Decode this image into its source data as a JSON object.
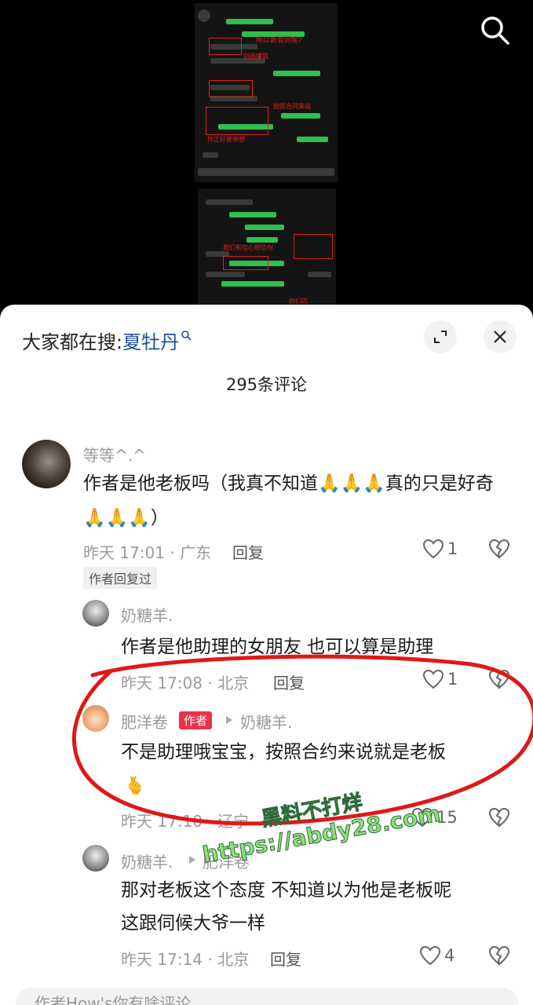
{
  "bg_photo": {
    "top_caption_1": "所以新合同呢?",
    "mid_caption_1": "别拖嫌我",
    "mid_caption_2": "按照合同来说",
    "lower_caption_1": "你正好要想想",
    "lower_caption_2": "我们有信心相信你",
    "lower_caption_3": "你们的"
  },
  "header": {
    "search_prefix": "大家都在搜:",
    "search_keyword": "夏牡丹"
  },
  "comments": {
    "count_label": "295条评论",
    "c1": {
      "author": "等等^.^",
      "text": "作者是他老板吗（我真不知道🙏🙏🙏真的只是好奇🙏🙏🙏）",
      "time": "昨天 17:01 · 广东",
      "reply_label": "回复",
      "likes": "1",
      "tag": "作者回复过"
    },
    "r1": {
      "author": "奶糖羊.",
      "text": "作者是他助理的女朋友 也可以算是助理",
      "time": "昨天 17:08 · 北京",
      "reply_label": "回复",
      "likes": "1"
    },
    "r2": {
      "author": "肥洋卷",
      "author_tag": "作者",
      "reply_to": "奶糖羊.",
      "text": "不是助理哦宝宝，按照合约来说就是老板",
      "emoji": "🫰",
      "time": "昨天 17:10 · 辽宁",
      "likes": "15"
    },
    "r3": {
      "author": "奶糖羊.",
      "reply_to": "肥洋卷",
      "text_line1": "那对老板这个态度 不知道以为他是老板呢",
      "text_line2": "这跟伺候大爷一样",
      "time": "昨天 17:14 · 北京",
      "reply_label": "回复",
      "likes": "4"
    }
  },
  "watermark": {
    "line1": "黑料不打烊",
    "line2": "https://abdy28.com"
  },
  "input": {
    "placeholder": "作者How's你有啥评论"
  }
}
